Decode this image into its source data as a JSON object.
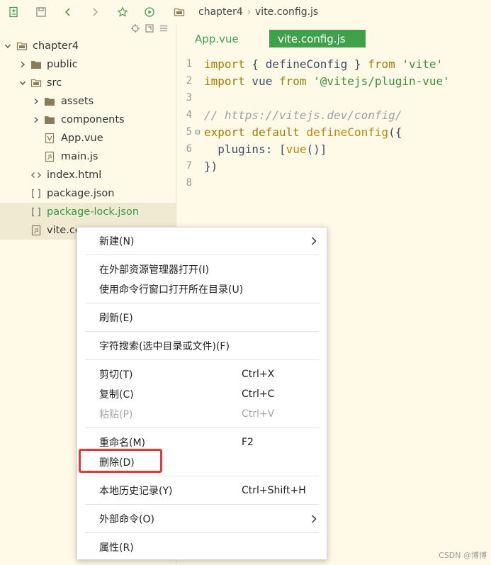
{
  "toolbar": {
    "icons": [
      "new-file-icon",
      "save-icon",
      "back-icon",
      "forward-icon",
      "star-icon",
      "run-icon",
      "folder-icon"
    ],
    "breadcrumb": [
      "chapter4",
      "vite.config.js"
    ]
  },
  "sidebar": {
    "tools": [
      "locate-icon",
      "collapse-icon",
      "menu-icon"
    ],
    "root": "chapter4",
    "items": [
      {
        "label": "public",
        "type": "folder"
      },
      {
        "label": "src",
        "type": "folder"
      },
      {
        "label": "assets",
        "type": "folder"
      },
      {
        "label": "components",
        "type": "folder"
      },
      {
        "label": "App.vue",
        "type": "vue-file"
      },
      {
        "label": "main.js",
        "type": "js-file"
      },
      {
        "label": "index.html",
        "type": "html-file"
      },
      {
        "label": "package.json",
        "type": "json-file"
      },
      {
        "label": "package-lock.json",
        "type": "json-file"
      },
      {
        "label": "vite.co",
        "type": "js-file"
      }
    ]
  },
  "editor": {
    "tabs": [
      "App.vue",
      "vite.config.js"
    ],
    "active_tab": "vite.config.js",
    "line_numbers": [
      "1",
      "2",
      "3",
      "4",
      "5",
      "6",
      "7",
      "8"
    ],
    "code": {
      "l1": [
        "import",
        " { ",
        "defineConfig",
        " } ",
        "from",
        " ",
        "'vite'"
      ],
      "l2": [
        "import",
        " vue ",
        "from",
        " ",
        "'@vitejs/plugin-vue'"
      ],
      "l4": "// https://vitejs.dev/config/",
      "l5": [
        "export",
        " ",
        "default",
        " ",
        "defineConfig",
        "({"
      ],
      "l6": [
        "  plugins: [",
        "vue",
        "()]"
      ],
      "l7": "})"
    }
  },
  "context_menu": {
    "items": {
      "new": {
        "label": "新建(N)"
      },
      "open_explorer": {
        "label": "在外部资源管理器打开(I)"
      },
      "open_cmd": {
        "label": "使用命令行窗口打开所在目录(U)"
      },
      "refresh": {
        "label": "刷新(E)"
      },
      "search": {
        "label": "字符搜索(选中目录或文件)(F)"
      },
      "cut": {
        "label": "剪切(T)",
        "shortcut": "Ctrl+X"
      },
      "copy": {
        "label": "复制(C)",
        "shortcut": "Ctrl+C"
      },
      "paste": {
        "label": "粘贴(P)",
        "shortcut": "Ctrl+V"
      },
      "rename": {
        "label": "重命名(M)",
        "shortcut": "F2"
      },
      "delete": {
        "label": "删除(D)"
      },
      "history": {
        "label": "本地历史记录(Y)",
        "shortcut": "Ctrl+Shift+H"
      },
      "external": {
        "label": "外部命令(O)"
      },
      "properties": {
        "label": "属性(R)"
      }
    }
  },
  "watermark": "CSDN @博博",
  "colors": {
    "accent_green": "#3fa24a",
    "highlight_red": "#e03a3a",
    "background": "#fffae8"
  }
}
